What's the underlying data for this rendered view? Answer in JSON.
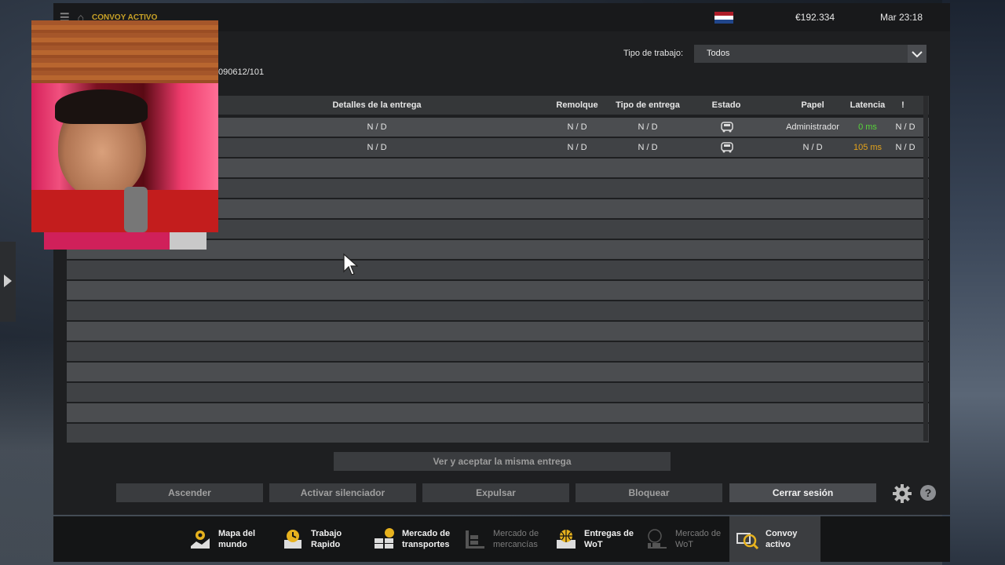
{
  "topbar": {
    "breadcrumb": "CONVOY ACTIVO",
    "money": "€192.334",
    "clock": "Mar 23:18",
    "flag_colors": [
      "#ae1c28",
      "#ffffff",
      "#21468b"
    ]
  },
  "session": {
    "reference": "090612/101"
  },
  "filter": {
    "label": "Tipo de trabajo:",
    "value": "Todos"
  },
  "table": {
    "headers": {
      "details": "Detalles de la entrega",
      "trailer": "Remolque",
      "delivery_type": "Tipo de entrega",
      "status": "Estado",
      "role": "Papel",
      "latency": "Latencia",
      "alert": "!"
    },
    "rows": [
      {
        "details": "N / D",
        "trailer": "N / D",
        "delivery_type": "N / D",
        "status_icon": "truck-icon",
        "role": "Administrador",
        "latency": "0 ms",
        "extra": "N / D"
      },
      {
        "details": "N / D",
        "trailer": "N / D",
        "delivery_type": "N / D",
        "status_icon": "truck-icon",
        "role": "N / D",
        "latency": "105 ms",
        "extra": "N / D"
      }
    ]
  },
  "actions": {
    "accept_same": "Ver y aceptar la misma entrega",
    "promote": "Ascender",
    "mute": "Activar silenciador",
    "kick": "Expulsar",
    "block": "Bloquear",
    "logout": "Cerrar sesión",
    "help": "?"
  },
  "nav": [
    {
      "label": "Mapa del mundo",
      "icon": "map-icon",
      "dim": false
    },
    {
      "label": "Trabajo Rapido",
      "icon": "clock-icon",
      "dim": false
    },
    {
      "label": "Mercado de transportes",
      "icon": "boxes-icon",
      "dim": false
    },
    {
      "label": "Mercado de mercancías",
      "icon": "forklift-icon",
      "dim": true
    },
    {
      "label": "Entregas de WoT",
      "icon": "globe-icon",
      "dim": false
    },
    {
      "label": "Mercado de WoT",
      "icon": "globe-forklift-icon",
      "dim": true
    },
    {
      "label": "Convoy activo",
      "icon": "convoy-icon",
      "dim": false,
      "selected": true
    }
  ],
  "colors": {
    "accent": "#c9a227",
    "latency_good": "#57d33a",
    "latency_warn": "#e3a21a"
  }
}
